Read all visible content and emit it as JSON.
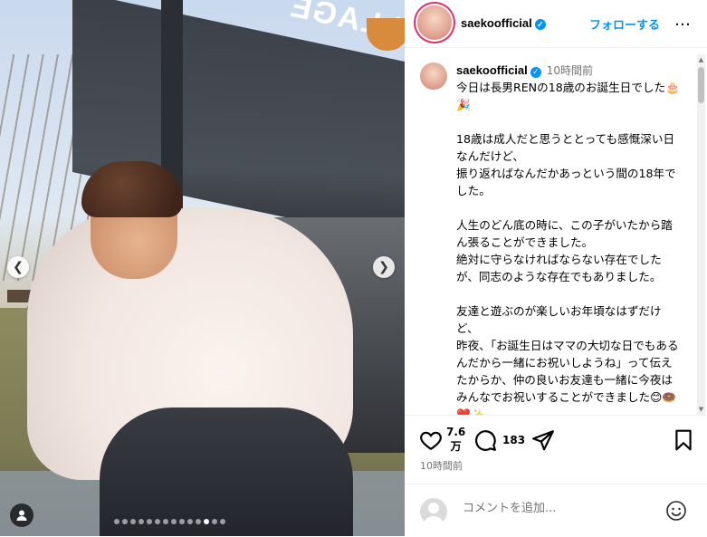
{
  "post": {
    "image_alt": "",
    "awning_text": "VILLAGE",
    "carousel": {
      "total_slides": 14,
      "active_slide": 12
    }
  },
  "header": {
    "username": "saekoofficial",
    "follow_label": "フォローする",
    "more_label": "…"
  },
  "caption": {
    "username": "saekoofficial",
    "time": "10時間前",
    "text": "今日は長男RENの18歳のお誕生日でした🎂🎉\n\n18歳は成人だと思うととっても感慨深い日なんだけど、\n振り返ればなんだかあっという間の18年でした。\n\n人生のどん底の時に、この子がいたから踏ん張ることができました。\n絶対に守らなければならない存在でしたが、同志のような存在でもありました。\n\n友達と遊ぶのが楽しいお年頃なはずだけど、\n昨夜、「お誕生日はママの大切な日でもあるんだから一緒にお祝いしようね」って伝えたからか、仲の良いお友達も一緒に今夜はみんなでお祝いすることができました😊🍩❤️✨"
  },
  "actions": {
    "likes_number": "7.6",
    "likes_unit": "万",
    "comments_count": "183",
    "post_time": "10時間前"
  },
  "comment_box": {
    "placeholder": "コメントを追加..."
  },
  "colors": {
    "accent": "#0095f6",
    "story_ring": "#e1306c",
    "muted": "#737373"
  }
}
